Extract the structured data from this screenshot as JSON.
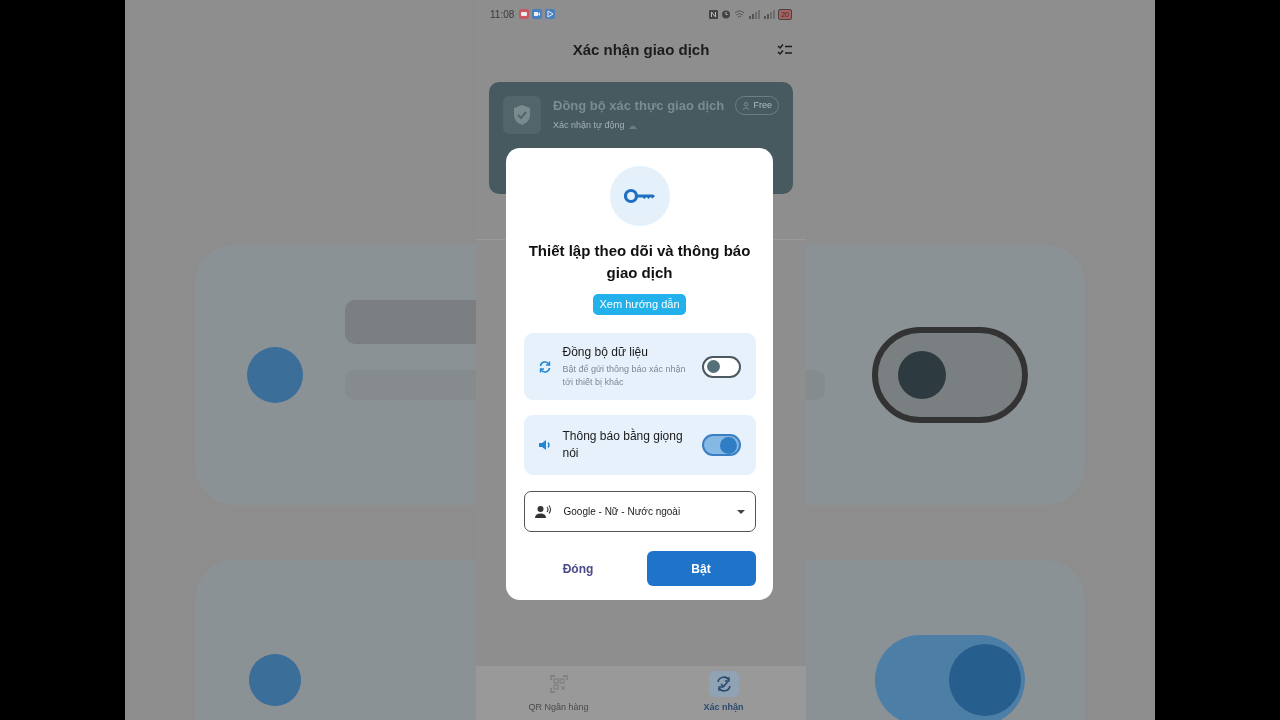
{
  "status_bar": {
    "time": "11:08",
    "battery": "20"
  },
  "header": {
    "title": "Xác nhận giao dịch"
  },
  "card": {
    "title": "Đồng bộ xác thực giao dịch",
    "subtitle": "Xác nhận tự động",
    "badge": "Free"
  },
  "dialog": {
    "title": "Thiết lập theo dõi và thông báo giao dịch",
    "guide_button": "Xem hướng dẫn",
    "options": [
      {
        "kind": "sync",
        "title": "Đồng bộ dữ liệu",
        "description": "Bật để gửi thông báo xác nhận tới thiết bị khác",
        "on": false
      },
      {
        "kind": "voice",
        "title": "Thông báo bằng giọng nói",
        "on": true
      }
    ],
    "voice_select": {
      "value": "Google - Nữ - Nước ngoài"
    },
    "buttons": [
      {
        "label": "Đóng",
        "kind": "text"
      },
      {
        "label": "Bật",
        "kind": "primary"
      }
    ]
  },
  "bottom_nav": [
    {
      "kind": "qr",
      "label": "QR Ngân hàng",
      "selected": false
    },
    {
      "kind": "confirm",
      "label": "Xác nhận",
      "selected": true
    }
  ]
}
